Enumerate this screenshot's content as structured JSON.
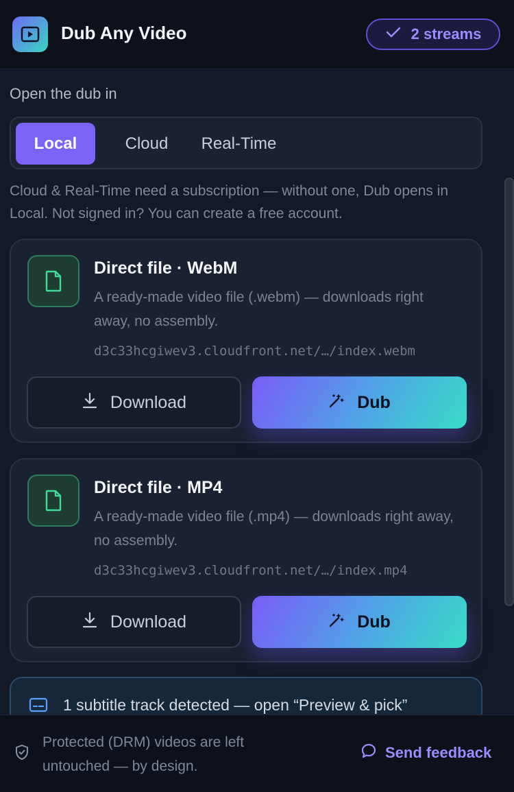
{
  "header": {
    "title": "Dub Any Video",
    "badge": "2 streams"
  },
  "target": {
    "label": "Open the dub in",
    "options": [
      "Local",
      "Cloud",
      "Real-Time"
    ],
    "selected": "Local",
    "note": "Cloud & Real-Time need a subscription — without one, Dub opens in Local. Not signed in? You can create a free account."
  },
  "streams": [
    {
      "title": "Direct file · WebM",
      "description": "A ready-made video file (.webm) — downloads right away, no assembly.",
      "url": "d3c33hcgiwev3.cloudfront.net/…/index.webm",
      "download_label": "Download",
      "dub_label": "Dub"
    },
    {
      "title": "Direct file · MP4",
      "description": "A ready-made video file (.mp4) — downloads right away, no assembly.",
      "url": "d3c33hcgiwev3.cloudfront.net/…/index.mp4",
      "download_label": "Download",
      "dub_label": "Dub"
    }
  ],
  "subtitles": {
    "text": "1 subtitle track detected — open “Preview & pick”"
  },
  "footer": {
    "note": "Protected (DRM) videos are left untouched — by design.",
    "feedback_label": "Send feedback"
  },
  "colors": {
    "accent": "#7b63f7",
    "gradient_start": "#7a5cf6",
    "gradient_end": "#38dcc6",
    "file_icon": "#3ddc97",
    "subtitle_icon": "#5aa0ff"
  }
}
